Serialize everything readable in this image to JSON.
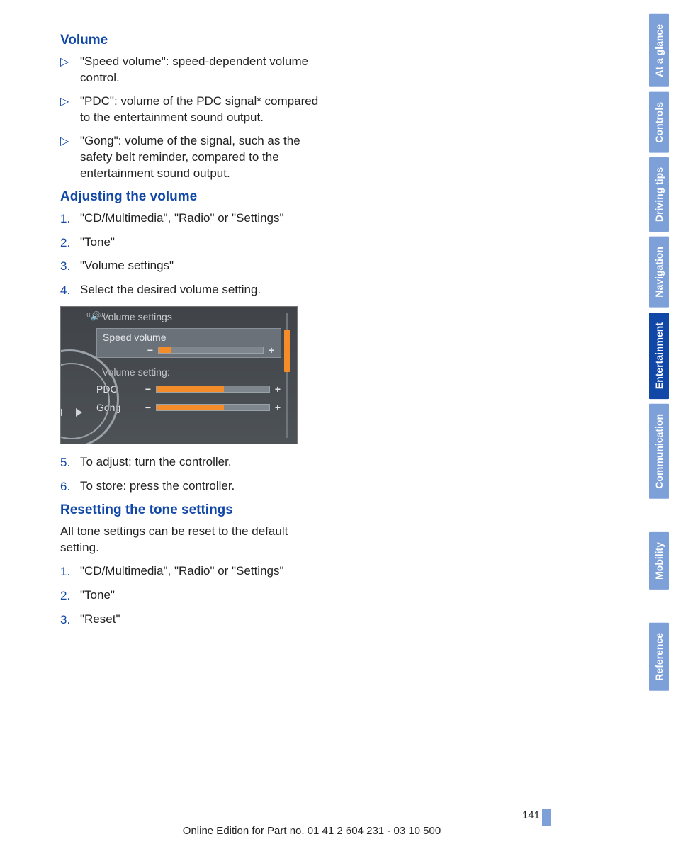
{
  "sections": {
    "volume": {
      "heading": "Volume",
      "items": [
        "\"Speed volume\": speed-dependent volume control.",
        "\"PDC\": volume of the PDC signal* compared to the entertainment sound output.",
        "\"Gong\": volume of the signal, such as the safety belt reminder, compared to the entertainment sound output."
      ]
    },
    "adjusting": {
      "heading": "Adjusting the volume",
      "steps_before": [
        "\"CD/Multimedia\", \"Radio\" or \"Settings\"",
        "\"Tone\"",
        "\"Volume settings\"",
        "Select the desired volume setting."
      ],
      "steps_after": [
        "To adjust: turn the controller.",
        "To store: press the controller."
      ]
    },
    "reset": {
      "heading": "Resetting the tone settings",
      "intro": "All tone settings can be reset to the default setting.",
      "steps": [
        "\"CD/Multimedia\", \"Radio\" or \"Settings\"",
        "\"Tone\"",
        "\"Reset\""
      ]
    }
  },
  "screenshot": {
    "title": "Volume settings",
    "selected_label": "Speed volume",
    "section_label": "Volume setting:",
    "row1": "PDC",
    "row2": "Gong",
    "minus": "−",
    "plus": "+",
    "fills": {
      "speed": 12,
      "pdc": 60,
      "gong": 60
    }
  },
  "side_tabs": [
    {
      "label": "At a glance",
      "active": false
    },
    {
      "label": "Controls",
      "active": false
    },
    {
      "label": "Driving tips",
      "active": false
    },
    {
      "label": "Navigation",
      "active": false
    },
    {
      "label": "Entertainment",
      "active": true
    },
    {
      "label": "Communication",
      "active": false
    },
    {
      "label": "Mobility",
      "active": false
    },
    {
      "label": "Reference",
      "active": false
    }
  ],
  "footer": {
    "page_number": "141",
    "line": "Online Edition for Part no. 01 41 2 604 231 - 03 10 500"
  },
  "bullet_glyph": "▷"
}
